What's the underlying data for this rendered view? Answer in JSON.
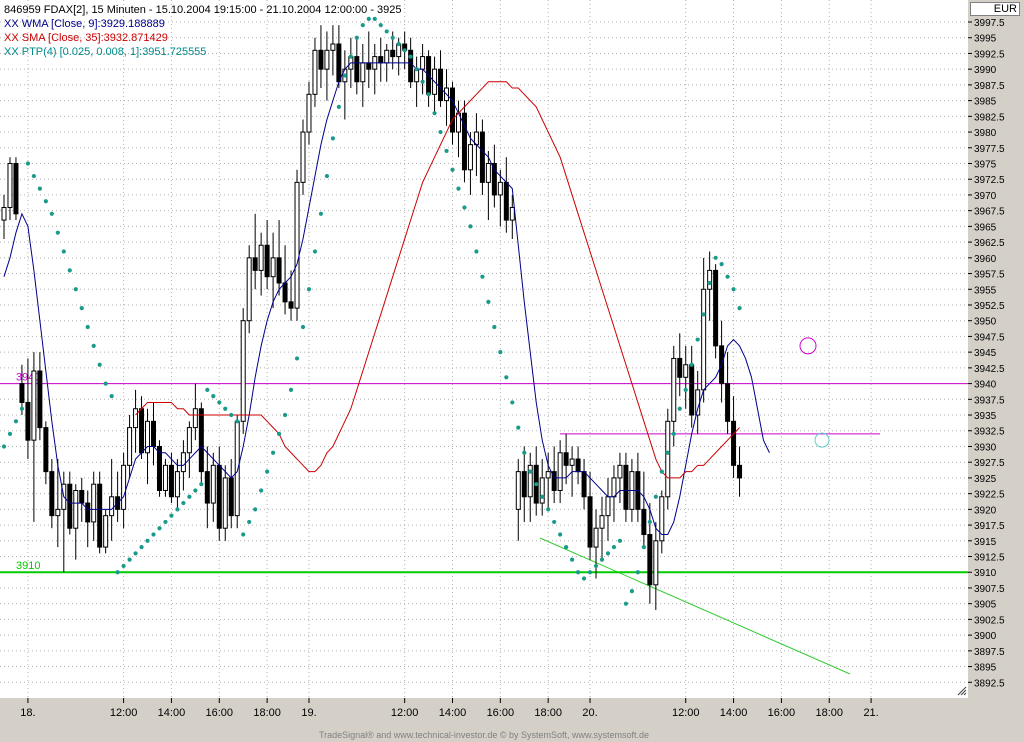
{
  "legend": {
    "title": "846959  FDAX[2], 15 Minuten - 15.10.2004 19:15:00 - 21.10.2004 12:00:00 - 3925",
    "wma": "XX WMA [Close, 9]:3929.188889",
    "sma": "XX SMA [Close, 35]:3932.871429",
    "ptp": "XX PTP(4) [0.025, 0.008, 1]:3951.725555"
  },
  "currency": "EUR",
  "footer": "TradeSignal® and www.technical-investor.de © by SystemSoft, www.systemsoft.de",
  "colors": {
    "candle": "#000000",
    "wma": "#00008b",
    "sma": "#cc0000",
    "ptp": "#1a9a8a",
    "resistance": "#cc00cc",
    "support": "#00cc00",
    "trendline": "#33cc33",
    "grid": "#b0b0b0"
  },
  "chart_data": {
    "type": "candlestick",
    "ylim": [
      3890,
      4001
    ],
    "y_ticks": [
      "3892.5",
      "3895",
      "3897.5",
      "3900",
      "3902.5",
      "3905",
      "3907.5",
      "3910",
      "3912.5",
      "3915",
      "3917.5",
      "3920",
      "3922.5",
      "3925",
      "3927.5",
      "3930",
      "3932.5",
      "3935",
      "3937.5",
      "3940",
      "3942.5",
      "3945",
      "3947.5",
      "3950",
      "3952.5",
      "3955",
      "3957.5",
      "3960",
      "3962.5",
      "3965",
      "3967.5",
      "3970",
      "3972.5",
      "3975",
      "3977.5",
      "3980",
      "3982.5",
      "3985",
      "3987.5",
      "3990",
      "3992.5",
      "3995",
      "3997.5"
    ],
    "x_ticks": [
      {
        "label": "18.",
        "bar": 4
      },
      {
        "label": "12:00",
        "bar": 20
      },
      {
        "label": "14:00",
        "bar": 28
      },
      {
        "label": "16:00",
        "bar": 36
      },
      {
        "label": "18:00",
        "bar": 44
      },
      {
        "label": "19.",
        "bar": 51
      },
      {
        "label": "12:00",
        "bar": 67
      },
      {
        "label": "14:00",
        "bar": 75
      },
      {
        "label": "16:00",
        "bar": 83
      },
      {
        "label": "18:00",
        "bar": 91
      },
      {
        "label": "20.",
        "bar": 98
      },
      {
        "label": "12:00",
        "bar": 114
      },
      {
        "label": "14:00",
        "bar": 122
      },
      {
        "label": "16:00",
        "bar": 130
      },
      {
        "label": "18:00",
        "bar": 138
      },
      {
        "label": "21.",
        "bar": 145
      }
    ],
    "ohlc": [
      [
        3966,
        3970,
        3963,
        3968
      ],
      [
        3968,
        3976,
        3966,
        3975
      ],
      [
        3975,
        3976,
        3966,
        3967
      ],
      [
        3940,
        3943,
        3935,
        3937
      ],
      [
        3937,
        3944,
        3928,
        3931
      ],
      [
        3931,
        3945,
        3918,
        3942
      ],
      [
        3942,
        3945,
        3931,
        3933
      ],
      [
        3933,
        3934,
        3924,
        3926
      ],
      [
        3926,
        3928,
        3917,
        3919
      ],
      [
        3919,
        3928,
        3914,
        3920
      ],
      [
        3920,
        3926,
        3910,
        3924
      ],
      [
        3924,
        3926,
        3916,
        3917
      ],
      [
        3917,
        3924,
        3912,
        3923
      ],
      [
        3923,
        3925,
        3918,
        3921
      ],
      [
        3921,
        3923,
        3914,
        3918
      ],
      [
        3918,
        3926,
        3915,
        3924
      ],
      [
        3924,
        3926,
        3913,
        3914
      ],
      [
        3914,
        3920,
        3913,
        3919
      ],
      [
        3919,
        3928,
        3915,
        3922
      ],
      [
        3922,
        3926,
        3918,
        3920
      ],
      [
        3920,
        3929,
        3917,
        3927
      ],
      [
        3927,
        3935,
        3925,
        3933
      ],
      [
        3933,
        3939,
        3929,
        3936
      ],
      [
        3936,
        3938,
        3928,
        3929
      ],
      [
        3929,
        3936,
        3924,
        3934
      ],
      [
        3934,
        3937,
        3927,
        3930
      ],
      [
        3930,
        3931,
        3922,
        3923
      ],
      [
        3923,
        3928,
        3922,
        3927
      ],
      [
        3927,
        3929,
        3921,
        3922
      ],
      [
        3922,
        3928,
        3920,
        3926
      ],
      [
        3926,
        3931,
        3923,
        3929
      ],
      [
        3929,
        3934,
        3925,
        3933
      ],
      [
        3933,
        3940,
        3931,
        3936
      ],
      [
        3936,
        3937,
        3924,
        3926
      ],
      [
        3926,
        3930,
        3917,
        3921
      ],
      [
        3921,
        3929,
        3918,
        3927
      ],
      [
        3927,
        3930,
        3915,
        3917
      ],
      [
        3917,
        3927,
        3915,
        3925
      ],
      [
        3925,
        3928,
        3917,
        3919
      ],
      [
        3919,
        3935,
        3917,
        3934
      ],
      [
        3934,
        3952,
        3932,
        3950
      ],
      [
        3950,
        3962,
        3948,
        3960
      ],
      [
        3960,
        3967,
        3955,
        3958
      ],
      [
        3958,
        3964,
        3954,
        3962
      ],
      [
        3962,
        3966,
        3955,
        3957
      ],
      [
        3957,
        3964,
        3952,
        3960
      ],
      [
        3960,
        3966,
        3954,
        3956
      ],
      [
        3956,
        3962,
        3951,
        3953
      ],
      [
        3953,
        3958,
        3950,
        3952
      ],
      [
        3952,
        3974,
        3950,
        3972
      ],
      [
        3972,
        3982,
        3970,
        3980
      ],
      [
        3980,
        3988,
        3978,
        3986
      ],
      [
        3986,
        3995,
        3984,
        3993
      ],
      [
        3993,
        3997,
        3987,
        3990
      ],
      [
        3990,
        3996,
        3985,
        3993
      ],
      [
        3993,
        3997,
        3989,
        3994
      ],
      [
        3994,
        3997,
        3987,
        3988
      ],
      [
        3988,
        3993,
        3982,
        3990
      ],
      [
        3990,
        3995,
        3987,
        3992
      ],
      [
        3992,
        3995,
        3986,
        3988
      ],
      [
        3988,
        3994,
        3984,
        3991
      ],
      [
        3991,
        3996,
        3987,
        3990
      ],
      [
        3990,
        3994,
        3986,
        3992
      ],
      [
        3992,
        3995,
        3988,
        3991
      ],
      [
        3991,
        3994,
        3988,
        3993
      ],
      [
        3993,
        3996,
        3990,
        3992
      ],
      [
        3992,
        3995,
        3989,
        3994
      ],
      [
        3994,
        3996,
        3990,
        3993
      ],
      [
        3993,
        3995,
        3987,
        3988
      ],
      [
        3988,
        3992,
        3984,
        3990
      ],
      [
        3990,
        3994,
        3986,
        3992
      ],
      [
        3992,
        3993,
        3984,
        3986
      ],
      [
        3986,
        3992,
        3983,
        3990
      ],
      [
        3990,
        3993,
        3984,
        3985
      ],
      [
        3985,
        3990,
        3981,
        3987
      ],
      [
        3987,
        3988,
        3978,
        3980
      ],
      [
        3980,
        3985,
        3976,
        3983
      ],
      [
        3983,
        3985,
        3972,
        3974
      ],
      [
        3974,
        3980,
        3970,
        3978
      ],
      [
        3978,
        3983,
        3973,
        3980
      ],
      [
        3980,
        3982,
        3970,
        3972
      ],
      [
        3972,
        3977,
        3966,
        3975
      ],
      [
        3975,
        3978,
        3968,
        3970
      ],
      [
        3970,
        3974,
        3965,
        3972
      ],
      [
        3972,
        3976,
        3964,
        3966
      ],
      [
        3966,
        3970,
        3963,
        3968
      ],
      [
        3920,
        3928,
        3915,
        3926
      ],
      [
        3926,
        3930,
        3918,
        3922
      ],
      [
        3922,
        3929,
        3918,
        3927
      ],
      [
        3927,
        3930,
        3919,
        3921
      ],
      [
        3921,
        3928,
        3919,
        3925
      ],
      [
        3925,
        3929,
        3920,
        3926
      ],
      [
        3926,
        3930,
        3921,
        3923
      ],
      [
        3923,
        3931,
        3921,
        3929
      ],
      [
        3929,
        3932,
        3924,
        3927
      ],
      [
        3927,
        3930,
        3922,
        3928
      ],
      [
        3928,
        3930,
        3924,
        3926
      ],
      [
        3926,
        3928,
        3920,
        3922
      ],
      [
        3922,
        3926,
        3912,
        3914
      ],
      [
        3914,
        3920,
        3909,
        3917
      ],
      [
        3917,
        3922,
        3912,
        3919
      ],
      [
        3919,
        3925,
        3915,
        3922
      ],
      [
        3922,
        3927,
        3918,
        3925
      ],
      [
        3925,
        3929,
        3921,
        3927
      ],
      [
        3927,
        3929,
        3918,
        3920
      ],
      [
        3920,
        3928,
        3918,
        3926
      ],
      [
        3926,
        3929,
        3918,
        3920
      ],
      [
        3920,
        3926,
        3914,
        3916
      ],
      [
        3916,
        3921,
        3905,
        3908
      ],
      [
        3908,
        3918,
        3904,
        3915
      ],
      [
        3915,
        3923,
        3913,
        3922
      ],
      [
        3922,
        3936,
        3920,
        3934
      ],
      [
        3934,
        3946,
        3930,
        3944
      ],
      [
        3944,
        3948,
        3938,
        3941
      ],
      [
        3941,
        3946,
        3936,
        3943
      ],
      [
        3943,
        3946,
        3933,
        3935
      ],
      [
        3935,
        3942,
        3932,
        3939
      ],
      [
        3939,
        3960,
        3937,
        3955
      ],
      [
        3955,
        3961,
        3950,
        3958
      ],
      [
        3958,
        3959,
        3944,
        3946
      ],
      [
        3946,
        3950,
        3937,
        3940
      ],
      [
        3940,
        3945,
        3932,
        3934
      ],
      [
        3934,
        3938,
        3925,
        3927
      ],
      [
        3927,
        3930,
        3922,
        3925
      ]
    ],
    "series": [
      {
        "name": "XX WMA [Close, 9]",
        "values": [
          3957,
          3960,
          3964,
          3967,
          3965,
          3958,
          3950,
          3942,
          3934,
          3927,
          3922,
          3921,
          3921,
          3921,
          3920,
          3920,
          3920,
          3920,
          3920,
          3921,
          3922,
          3925,
          3928,
          3929,
          3930,
          3930,
          3929,
          3929,
          3928,
          3927,
          3927,
          3928,
          3929,
          3930,
          3929,
          3928,
          3927,
          3926,
          3925,
          3926,
          3930,
          3935,
          3941,
          3946,
          3950,
          3953,
          3955,
          3956,
          3957,
          3959,
          3963,
          3968,
          3973,
          3978,
          3982,
          3985,
          3988,
          3990,
          3991,
          3991,
          3991,
          3991,
          3991,
          3991,
          3991,
          3991,
          3991,
          3991,
          3991,
          3990,
          3990,
          3989,
          3988,
          3987,
          3986,
          3985,
          3983,
          3981,
          3979,
          3978,
          3977,
          3976,
          3974,
          3973,
          3972,
          3971,
          3962,
          3953,
          3945,
          3937,
          3931,
          3927,
          3925,
          3925,
          3925,
          3926,
          3926,
          3926,
          3925,
          3924,
          3923,
          3922,
          3922,
          3923,
          3923,
          3923,
          3923,
          3922,
          3920,
          3917,
          3916,
          3916,
          3918,
          3922,
          3927,
          3932,
          3936,
          3939,
          3940,
          3941,
          3943,
          3946,
          3947,
          3946,
          3944,
          3941,
          3936,
          3931,
          3929
        ]
      },
      {
        "name": "XX SMA [Close, 35]",
        "values": [
          3935,
          3936,
          3937,
          3937,
          3937,
          3937,
          3937,
          3936,
          3936,
          3935,
          3935,
          3935,
          3935,
          3935,
          3935,
          3935,
          3935,
          3935,
          3935,
          3935,
          3935,
          3935,
          3934,
          3933,
          3932,
          3930,
          3929,
          3928,
          3927,
          3926,
          3926,
          3927,
          3929,
          3930,
          3932,
          3934,
          3936,
          3939,
          3942,
          3945,
          3948,
          3951,
          3954,
          3957,
          3960,
          3963,
          3966,
          3969,
          3972,
          3974,
          3976,
          3978,
          3980,
          3982,
          3983,
          3984,
          3985,
          3986,
          3987,
          3988,
          3988,
          3988,
          3988,
          3987,
          3987,
          3986,
          3985,
          3984,
          3982,
          3980,
          3978,
          3976,
          3973,
          3970,
          3967,
          3964,
          3961,
          3958,
          3955,
          3952,
          3949,
          3946,
          3943,
          3940,
          3937,
          3934,
          3931,
          3928,
          3926,
          3925,
          3925,
          3925,
          3926,
          3926,
          3927,
          3927,
          3928,
          3929,
          3930,
          3931,
          3932,
          3933
        ]
      },
      {
        "name": "XX PTP(4) [0.025, 0.008, 1]",
        "values": [
          3930,
          3932,
          3934,
          3936,
          3975,
          3973,
          3971,
          3969,
          3967,
          3964,
          3961,
          3958,
          3955,
          3952,
          3949,
          3946,
          3943,
          3940,
          3938,
          3910,
          3911,
          3912,
          3913,
          3914,
          3915,
          3916,
          3917,
          3918,
          3919,
          3920,
          3921,
          3922,
          3923,
          3924,
          3939,
          3938,
          3937,
          3936,
          3935,
          3934,
          3916,
          3918,
          3920,
          3923,
          3926,
          3929,
          3932,
          3935,
          3939,
          3944,
          3949,
          3955,
          3961,
          3967,
          3973,
          3979,
          3984,
          3989,
          3992,
          3995,
          3997,
          3998,
          3998,
          3997,
          3996,
          3995,
          3994,
          3993,
          3992,
          3990,
          3988,
          3986,
          3983,
          3980,
          3977,
          3974,
          3971,
          3968,
          3965,
          3961,
          3957,
          3953,
          3949,
          3945,
          3941,
          3937,
          3933,
          3929,
          3926,
          3924,
          3922,
          3920,
          3918,
          3916,
          3914,
          3912,
          3910,
          3909,
          3910,
          3911,
          3912,
          3913,
          3914,
          3915,
          3905,
          3907,
          3910,
          3914,
          3918,
          3922,
          3926,
          3929,
          3932,
          3936,
          3939,
          3943,
          3947,
          3951,
          3956,
          3960,
          3959,
          3957,
          3955,
          3952
        ]
      }
    ],
    "horizontal_lines": [
      {
        "label": "3940",
        "value": 3940
      },
      {
        "label": "3910",
        "value": 3910
      }
    ]
  }
}
